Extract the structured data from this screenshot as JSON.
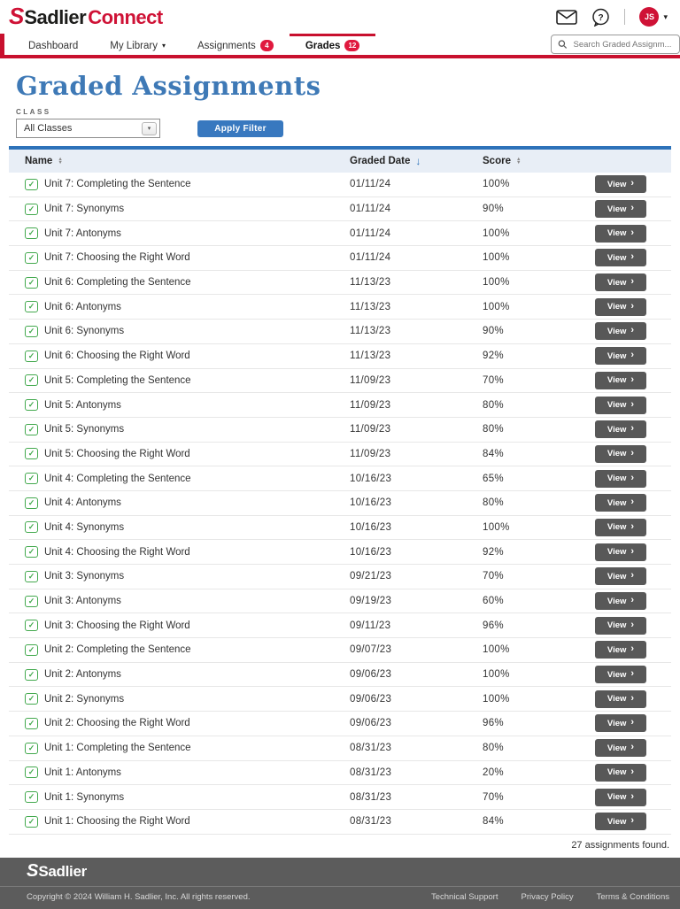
{
  "header": {
    "logo_mark": "S",
    "logo_brand": "Sadlier",
    "logo_suffix": "Connect",
    "avatar_initials": "JS"
  },
  "nav": {
    "items": [
      {
        "label": "Dashboard"
      },
      {
        "label": "My Library"
      },
      {
        "label": "Assignments",
        "badge": "4"
      },
      {
        "label": "Grades",
        "badge": "12"
      }
    ],
    "search_placeholder": "Search Graded Assignm..."
  },
  "page": {
    "title": "Graded Assignments",
    "filter_label": "CLASS",
    "filter_selected": "All Classes",
    "apply_button": "Apply Filter"
  },
  "table": {
    "columns": [
      {
        "label": "Name",
        "sort": "none"
      },
      {
        "label": "Graded Date",
        "sort": "desc"
      },
      {
        "label": "Score",
        "sort": "none"
      }
    ],
    "view_label": "View",
    "rows": [
      {
        "name": "Unit 7: Completing the Sentence",
        "date": "01/11/24",
        "score": "100%"
      },
      {
        "name": "Unit 7: Synonyms",
        "date": "01/11/24",
        "score": "90%"
      },
      {
        "name": "Unit 7: Antonyms",
        "date": "01/11/24",
        "score": "100%"
      },
      {
        "name": "Unit 7: Choosing the Right Word",
        "date": "01/11/24",
        "score": "100%"
      },
      {
        "name": "Unit 6: Completing the Sentence",
        "date": "11/13/23",
        "score": "100%"
      },
      {
        "name": "Unit 6: Antonyms",
        "date": "11/13/23",
        "score": "100%"
      },
      {
        "name": "Unit 6: Synonyms",
        "date": "11/13/23",
        "score": "90%"
      },
      {
        "name": "Unit 6: Choosing the Right Word",
        "date": "11/13/23",
        "score": "92%"
      },
      {
        "name": "Unit 5: Completing the Sentence",
        "date": "11/09/23",
        "score": "70%"
      },
      {
        "name": "Unit 5: Antonyms",
        "date": "11/09/23",
        "score": "80%"
      },
      {
        "name": "Unit 5: Synonyms",
        "date": "11/09/23",
        "score": "80%"
      },
      {
        "name": "Unit 5: Choosing the Right Word",
        "date": "11/09/23",
        "score": "84%"
      },
      {
        "name": "Unit 4: Completing the Sentence",
        "date": "10/16/23",
        "score": "65%"
      },
      {
        "name": "Unit 4: Antonyms",
        "date": "10/16/23",
        "score": "80%"
      },
      {
        "name": "Unit 4: Synonyms",
        "date": "10/16/23",
        "score": "100%"
      },
      {
        "name": "Unit 4: Choosing the Right Word",
        "date": "10/16/23",
        "score": "92%"
      },
      {
        "name": "Unit 3: Synonyms",
        "date": "09/21/23",
        "score": "70%"
      },
      {
        "name": "Unit 3: Antonyms",
        "date": "09/19/23",
        "score": "60%"
      },
      {
        "name": "Unit 3: Choosing the Right Word",
        "date": "09/11/23",
        "score": "96%"
      },
      {
        "name": "Unit 2: Completing the Sentence",
        "date": "09/07/23",
        "score": "100%"
      },
      {
        "name": "Unit 2: Antonyms",
        "date": "09/06/23",
        "score": "100%"
      },
      {
        "name": "Unit 2: Synonyms",
        "date": "09/06/23",
        "score": "100%"
      },
      {
        "name": "Unit 2: Choosing the Right Word",
        "date": "09/06/23",
        "score": "96%"
      },
      {
        "name": "Unit 1: Completing the Sentence",
        "date": "08/31/23",
        "score": "80%"
      },
      {
        "name": "Unit 1: Antonyms",
        "date": "08/31/23",
        "score": "20%"
      },
      {
        "name": "Unit 1: Synonyms",
        "date": "08/31/23",
        "score": "70%"
      },
      {
        "name": "Unit 1: Choosing the Right Word",
        "date": "08/31/23",
        "score": "84%"
      }
    ],
    "found_text": "27 assignments found."
  },
  "footer": {
    "logo_mark": "S",
    "logo_word": "Sadlier",
    "copyright": "Copyright © 2024 William H. Sadlier, Inc. All rights reserved.",
    "links": [
      "Technical Support",
      "Privacy Policy",
      "Terms & Conditions"
    ]
  },
  "icons": {
    "check": "✓",
    "chevron_right": "›",
    "caret_down": "▾",
    "sort_up": "▲",
    "sort_down": "▼",
    "arrow_down": "↓"
  },
  "colors": {
    "brand_red": "#cf1236",
    "nav_red": "#c8102e",
    "title_blue": "#3e79b6",
    "button_blue": "#3878bf",
    "table_blue": "#2d72b9",
    "header_row_bg": "#e8eef6",
    "view_button_gray": "#585858",
    "check_green": "#43a94e",
    "footer_gray": "#5c5c5c"
  }
}
